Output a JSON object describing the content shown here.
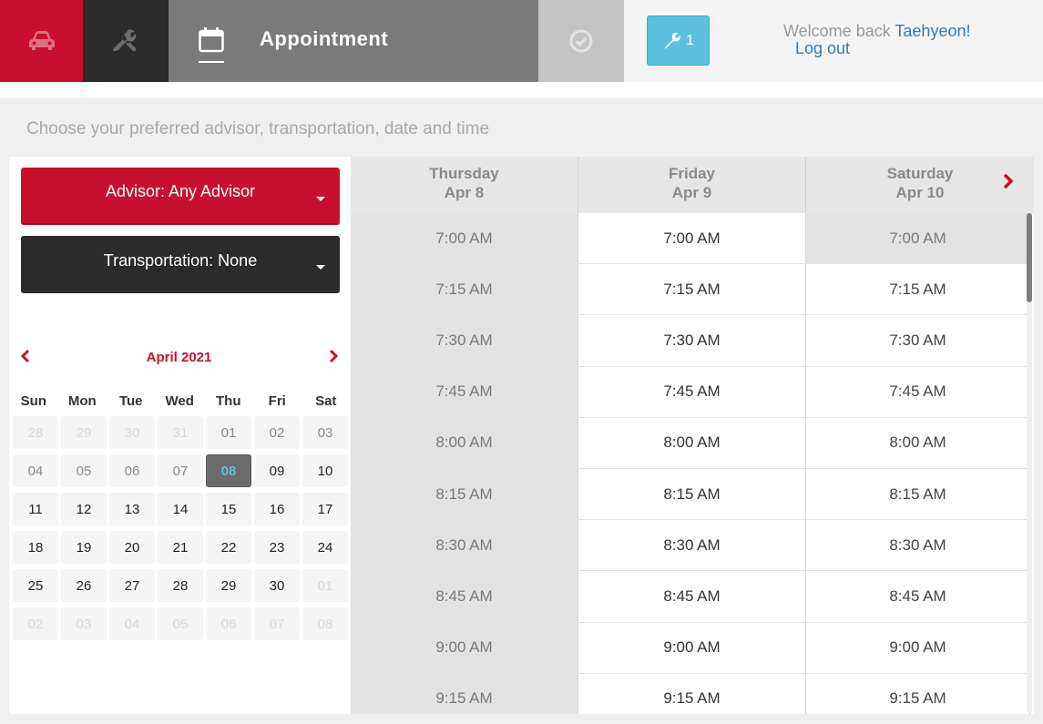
{
  "steps": {
    "vehicle_icon": "car-icon",
    "services_icon": "wrench-icon",
    "appointment_icon": "calendar-icon",
    "appointment_title": "Appointment",
    "confirm_icon": "check-circle-icon"
  },
  "service_badge": {
    "icon": "wrench-icon",
    "count": "1"
  },
  "user": {
    "welcome": "Welcome back",
    "name": "Taehyeon!",
    "logout": "Log out"
  },
  "instruction": "Choose your preferred advisor, transportation, date and time",
  "advisor_dropdown": {
    "label": "Advisor: Any Advisor"
  },
  "transportation_dropdown": {
    "label": "Transportation: None"
  },
  "calendar": {
    "month": "April 2021",
    "weekdays": [
      "Sun",
      "Mon",
      "Tue",
      "Wed",
      "Thu",
      "Fri",
      "Sat"
    ],
    "weeks": [
      [
        "28",
        "29",
        "30",
        "31",
        "01",
        "02",
        "03"
      ],
      [
        "04",
        "05",
        "06",
        "07",
        "08",
        "09",
        "10"
      ],
      [
        "11",
        "12",
        "13",
        "14",
        "15",
        "16",
        "17"
      ],
      [
        "18",
        "19",
        "20",
        "21",
        "22",
        "23",
        "24"
      ],
      [
        "25",
        "26",
        "27",
        "28",
        "29",
        "30",
        "01"
      ],
      [
        "02",
        "03",
        "04",
        "05",
        "06",
        "07",
        "08"
      ]
    ],
    "selected": "08"
  },
  "schedule": {
    "days": [
      {
        "weekday": "Thursday",
        "date": "Apr 8"
      },
      {
        "weekday": "Friday",
        "date": "Apr 9"
      },
      {
        "weekday": "Saturday",
        "date": "Apr 10"
      }
    ],
    "times": [
      "7:00 AM",
      "7:15 AM",
      "7:30 AM",
      "7:45 AM",
      "8:00 AM",
      "8:15 AM",
      "8:30 AM",
      "8:45 AM",
      "9:00 AM",
      "9:15 AM"
    ]
  },
  "colors": {
    "brand_red": "#c8102e",
    "dark": "#2b2b2b",
    "active_step": "#7a7a7a",
    "info_blue": "#5bc0de",
    "link_blue": "#337ab7"
  }
}
